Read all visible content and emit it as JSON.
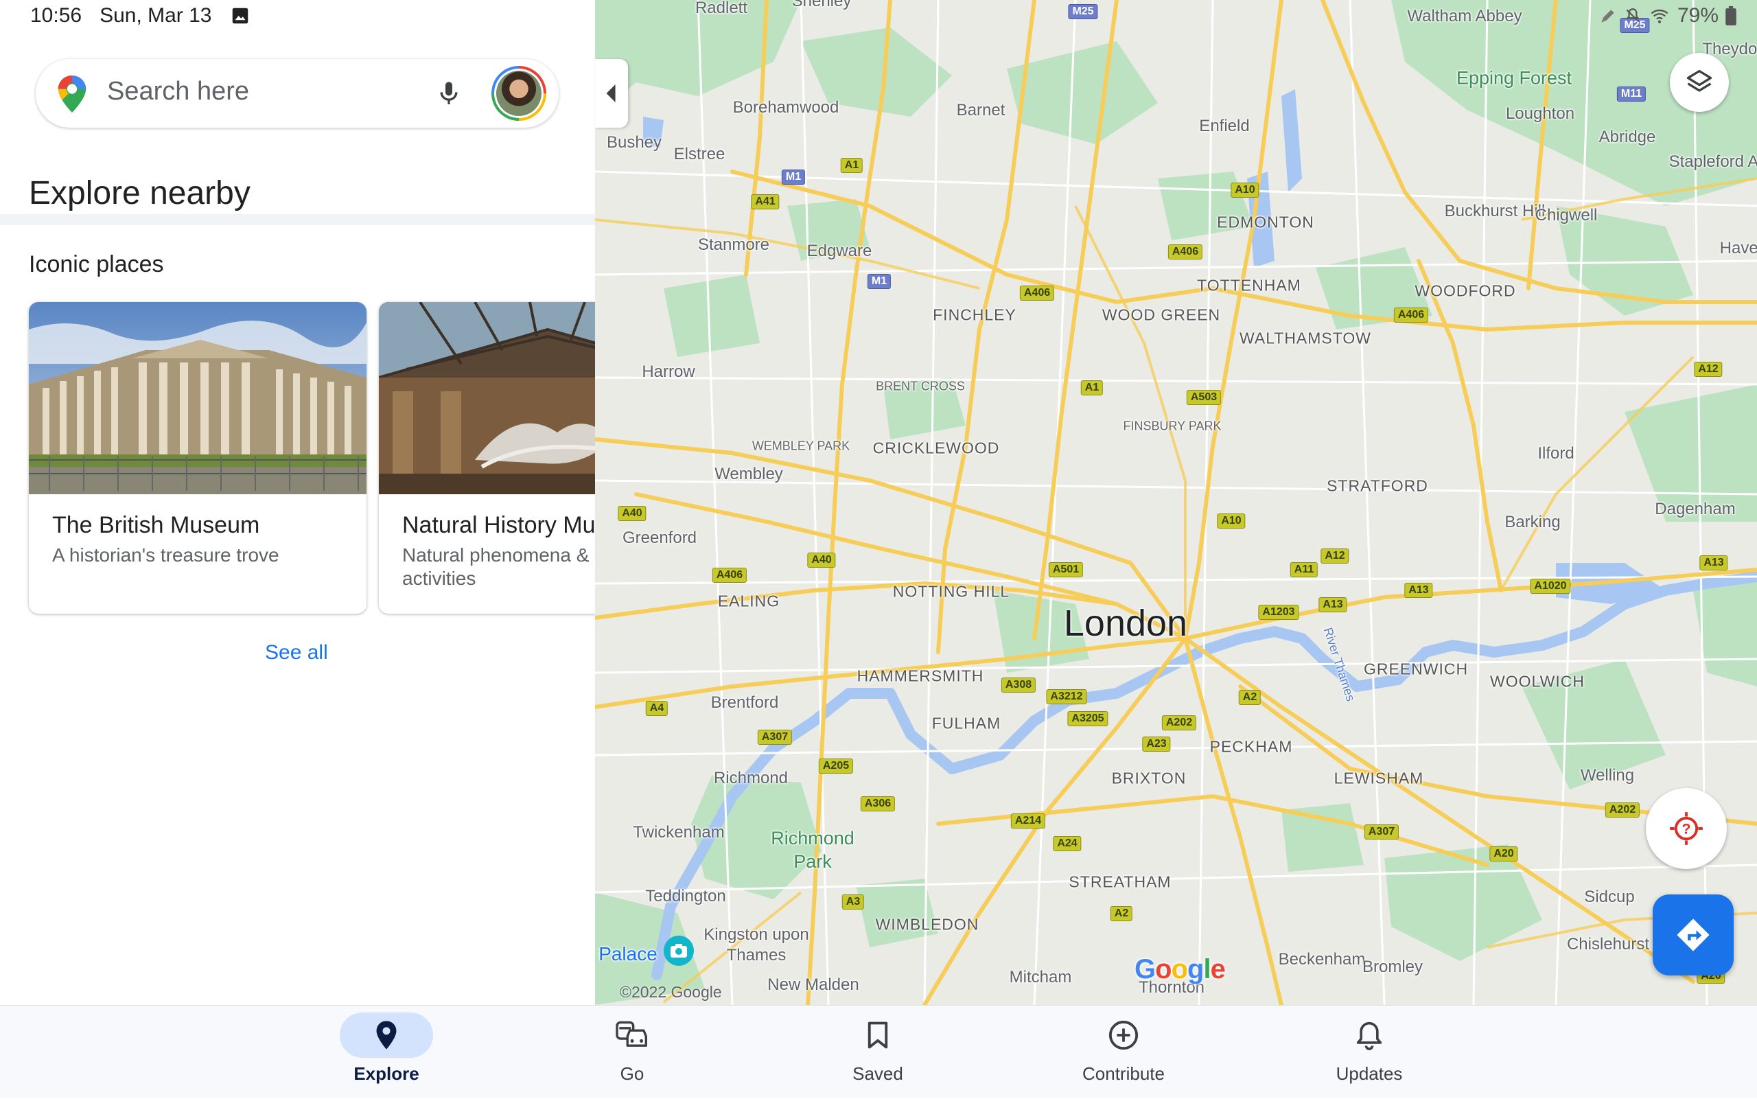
{
  "status_bar": {
    "time": "10:56",
    "date": "Sun, Mar 13",
    "battery": "79%"
  },
  "search": {
    "placeholder": "Search here"
  },
  "explore": {
    "title": "Explore nearby",
    "section_title": "Iconic places",
    "cards": [
      {
        "title": "The British Museum",
        "subtitle": "A historian's treasure trove"
      },
      {
        "title": "Natural History Museum",
        "subtitle": "Natural phenomena & hands-on activities"
      }
    ],
    "see_all": "See all"
  },
  "map": {
    "city": "London",
    "labels": [
      "Radlett",
      "Shenley",
      "Waltham Abbey",
      "Theydon",
      "Epping Forest",
      "Loughton",
      "Abridge",
      "Borehamwood",
      "Barnet",
      "Enfield",
      "Bushey",
      "Elstree",
      "EDMONTON",
      "Buckhurst Hill",
      "Chigwell",
      "Stanmore",
      "Edgware",
      "TOTTENHAM",
      "WOODFORD",
      "FINCHLEY",
      "WOOD GREEN",
      "WALTHAMSTOW",
      "Harrow",
      "BRENT CROSS",
      "FINSBURY PARK",
      "Ilford",
      "WEMBLEY PARK",
      "CRICKLEWOOD",
      "Wembley",
      "STRATFORD",
      "Barking",
      "Dagenham",
      "Greenford",
      "EALING",
      "NOTTING HILL",
      "HAMMERSMITH",
      "GREENWICH",
      "WOOLWICH",
      "Brentford",
      "FULHAM",
      "PECKHAM",
      "Richmond",
      "BRIXTON",
      "LEWISHAM",
      "Welling",
      "Twickenham",
      "Richmond Park",
      "STREATHAM",
      "Teddington",
      "WIMBLEDON",
      "Sidcup",
      "Kingston upon Thames",
      "Chislehurst",
      "Palace",
      "Mitcham",
      "Beckenham",
      "Bromley",
      "New Malden",
      "Thornton",
      "River Thames",
      "Haverin",
      "Stapleford Abbo"
    ],
    "roads": [
      "M25",
      "A1",
      "M1",
      "A41",
      "A10",
      "A406",
      "A503",
      "A12",
      "A13",
      "A1203",
      "A1020",
      "A11",
      "A501",
      "A40",
      "A4",
      "A307",
      "A205",
      "A306",
      "A3",
      "A308",
      "A3212",
      "A3205",
      "A202",
      "A2",
      "A23",
      "A214",
      "A24",
      "A20",
      "M11"
    ],
    "copyright": "©2022 Google",
    "google_logo": "Google"
  },
  "nav": [
    {
      "label": "Explore",
      "icon": "place-pin-icon",
      "active": true
    },
    {
      "label": "Go",
      "icon": "commute-icon",
      "active": false
    },
    {
      "label": "Saved",
      "icon": "bookmark-icon",
      "active": false
    },
    {
      "label": "Contribute",
      "icon": "add-circle-icon",
      "active": false
    },
    {
      "label": "Updates",
      "icon": "bell-icon",
      "active": false
    }
  ],
  "colors": {
    "accent": "#1a73e8",
    "nav_active_pill": "#d3e3fd",
    "road_badge": "#c7c82a",
    "motorway": "#6c7dc9",
    "water": "#a9c6f5",
    "park": "#bfe3c4"
  }
}
